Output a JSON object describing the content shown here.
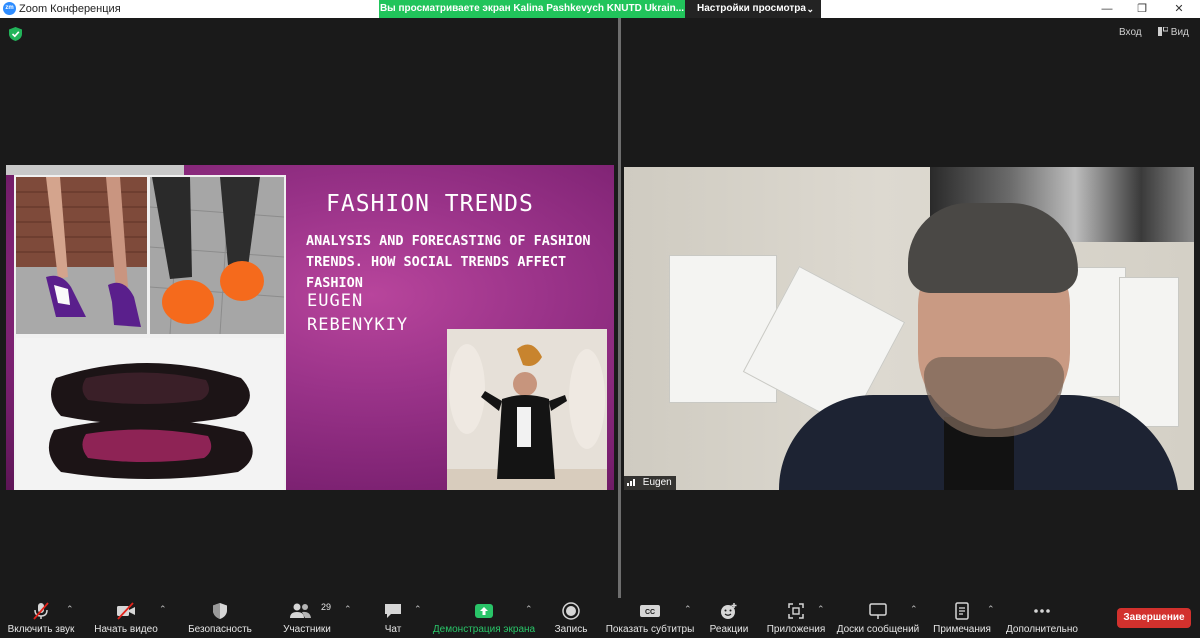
{
  "window": {
    "title": "Zoom Конференция",
    "share_banner": "Вы просматриваете экран Kalina Pashkevych KNUTD Ukrain...",
    "view_options": "Настройки просмотра"
  },
  "topbar": {
    "enter_label": "Вход",
    "view_label": "Вид"
  },
  "slide": {
    "title": "FASHION TRENDS",
    "subtitle": "ANALYSIS AND FORECASTING OF FASHION TRENDS. HOW SOCIAL TRENDS AFFECT FASHION",
    "author": "EUGEN REBENYKIY"
  },
  "video": {
    "participant_name": "Eugen"
  },
  "toolbar": {
    "mute_label": "Включить звук",
    "video_label": "Начать видео",
    "security_label": "Безопасность",
    "participants_label": "Участники",
    "participants_count": "29",
    "chat_label": "Чат",
    "share_label": "Демонстрация экрана",
    "record_label": "Запись",
    "captions_label": "Показать субтитры",
    "captions_icon_text": "CC",
    "reactions_label": "Реакции",
    "apps_label": "Приложения",
    "whiteboards_label": "Доски сообщений",
    "notes_label": "Примечания",
    "more_label": "Дополнительно",
    "end_label": "Завершение"
  },
  "colors": {
    "share_banner": "#21c45b",
    "end_button": "#d2312d",
    "slide_purple": "#9a3389",
    "share_label": "#29c468"
  }
}
